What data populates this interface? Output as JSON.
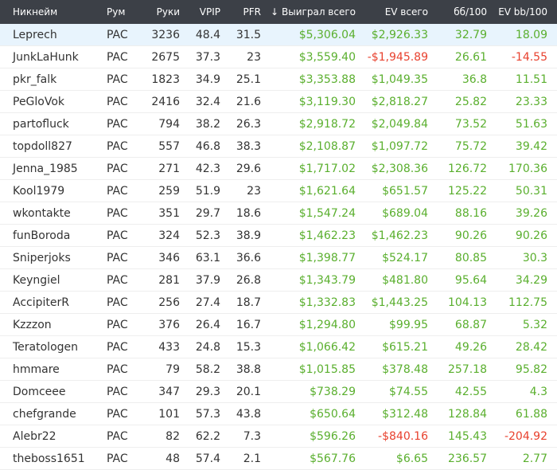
{
  "columns": {
    "nickname": "Никнейм",
    "room": "Рум",
    "hands": "Руки",
    "vpip": "VPIP",
    "pfr": "PFR",
    "sort_icon": "↓",
    "won_total": "Выиграл всего",
    "ev_total": "EV всего",
    "bb100": "бб/100",
    "ev_bb100": "EV bb/100"
  },
  "colors": {
    "header_bg": "#3c4047",
    "positive": "#5aaf2e",
    "negative": "#e8412e",
    "selected_row": "#e8f4fd"
  },
  "rows": [
    {
      "name": "Leprech",
      "room": "PAC",
      "hands": "3236",
      "vpip": "48.4",
      "pfr": "31.5",
      "won": "$5,306.04",
      "won_neg": false,
      "ev": "$2,926.33",
      "ev_neg": false,
      "bb100": "32.79",
      "bb100_neg": false,
      "evbb": "18.09",
      "evbb_neg": false,
      "selected": true
    },
    {
      "name": "JunkLaHunk",
      "room": "PAC",
      "hands": "2675",
      "vpip": "37.3",
      "pfr": "23",
      "won": "$3,559.40",
      "won_neg": false,
      "ev": "-$1,945.89",
      "ev_neg": true,
      "bb100": "26.61",
      "bb100_neg": false,
      "evbb": "-14.55",
      "evbb_neg": true,
      "selected": false
    },
    {
      "name": "pkr_falk",
      "room": "PAC",
      "hands": "1823",
      "vpip": "34.9",
      "pfr": "25.1",
      "won": "$3,353.88",
      "won_neg": false,
      "ev": "$1,049.35",
      "ev_neg": false,
      "bb100": "36.8",
      "bb100_neg": false,
      "evbb": "11.51",
      "evbb_neg": false,
      "selected": false
    },
    {
      "name": "PeGloVok",
      "room": "PAC",
      "hands": "2416",
      "vpip": "32.4",
      "pfr": "21.6",
      "won": "$3,119.30",
      "won_neg": false,
      "ev": "$2,818.27",
      "ev_neg": false,
      "bb100": "25.82",
      "bb100_neg": false,
      "evbb": "23.33",
      "evbb_neg": false,
      "selected": false
    },
    {
      "name": "partofluck",
      "room": "PAC",
      "hands": "794",
      "vpip": "38.2",
      "pfr": "26.3",
      "won": "$2,918.72",
      "won_neg": false,
      "ev": "$2,049.84",
      "ev_neg": false,
      "bb100": "73.52",
      "bb100_neg": false,
      "evbb": "51.63",
      "evbb_neg": false,
      "selected": false
    },
    {
      "name": "topdoll827",
      "room": "PAC",
      "hands": "557",
      "vpip": "46.8",
      "pfr": "38.3",
      "won": "$2,108.87",
      "won_neg": false,
      "ev": "$1,097.72",
      "ev_neg": false,
      "bb100": "75.72",
      "bb100_neg": false,
      "evbb": "39.42",
      "evbb_neg": false,
      "selected": false
    },
    {
      "name": "Jenna_1985",
      "room": "PAC",
      "hands": "271",
      "vpip": "42.3",
      "pfr": "29.6",
      "won": "$1,717.02",
      "won_neg": false,
      "ev": "$2,308.36",
      "ev_neg": false,
      "bb100": "126.72",
      "bb100_neg": false,
      "evbb": "170.36",
      "evbb_neg": false,
      "selected": false
    },
    {
      "name": "Kool1979",
      "room": "PAC",
      "hands": "259",
      "vpip": "51.9",
      "pfr": "23",
      "won": "$1,621.64",
      "won_neg": false,
      "ev": "$651.57",
      "ev_neg": false,
      "bb100": "125.22",
      "bb100_neg": false,
      "evbb": "50.31",
      "evbb_neg": false,
      "selected": false
    },
    {
      "name": "wkontakte",
      "room": "PAC",
      "hands": "351",
      "vpip": "29.7",
      "pfr": "18.6",
      "won": "$1,547.24",
      "won_neg": false,
      "ev": "$689.04",
      "ev_neg": false,
      "bb100": "88.16",
      "bb100_neg": false,
      "evbb": "39.26",
      "evbb_neg": false,
      "selected": false
    },
    {
      "name": "funBoroda",
      "room": "PAC",
      "hands": "324",
      "vpip": "52.3",
      "pfr": "38.9",
      "won": "$1,462.23",
      "won_neg": false,
      "ev": "$1,462.23",
      "ev_neg": false,
      "bb100": "90.26",
      "bb100_neg": false,
      "evbb": "90.26",
      "evbb_neg": false,
      "selected": false
    },
    {
      "name": "Sniperjoks",
      "room": "PAC",
      "hands": "346",
      "vpip": "63.1",
      "pfr": "36.6",
      "won": "$1,398.77",
      "won_neg": false,
      "ev": "$524.17",
      "ev_neg": false,
      "bb100": "80.85",
      "bb100_neg": false,
      "evbb": "30.3",
      "evbb_neg": false,
      "selected": false
    },
    {
      "name": "Keyngiel",
      "room": "PAC",
      "hands": "281",
      "vpip": "37.9",
      "pfr": "26.8",
      "won": "$1,343.79",
      "won_neg": false,
      "ev": "$481.80",
      "ev_neg": false,
      "bb100": "95.64",
      "bb100_neg": false,
      "evbb": "34.29",
      "evbb_neg": false,
      "selected": false
    },
    {
      "name": "AccipiterR",
      "room": "PAC",
      "hands": "256",
      "vpip": "27.4",
      "pfr": "18.7",
      "won": "$1,332.83",
      "won_neg": false,
      "ev": "$1,443.25",
      "ev_neg": false,
      "bb100": "104.13",
      "bb100_neg": false,
      "evbb": "112.75",
      "evbb_neg": false,
      "selected": false
    },
    {
      "name": "Kzzzon",
      "room": "PAC",
      "hands": "376",
      "vpip": "26.4",
      "pfr": "16.7",
      "won": "$1,294.80",
      "won_neg": false,
      "ev": "$99.95",
      "ev_neg": false,
      "bb100": "68.87",
      "bb100_neg": false,
      "evbb": "5.32",
      "evbb_neg": false,
      "selected": false
    },
    {
      "name": "Teratologen",
      "room": "PAC",
      "hands": "433",
      "vpip": "24.8",
      "pfr": "15.3",
      "won": "$1,066.42",
      "won_neg": false,
      "ev": "$615.21",
      "ev_neg": false,
      "bb100": "49.26",
      "bb100_neg": false,
      "evbb": "28.42",
      "evbb_neg": false,
      "selected": false
    },
    {
      "name": "hmmare",
      "room": "PAC",
      "hands": "79",
      "vpip": "58.2",
      "pfr": "38.8",
      "won": "$1,015.85",
      "won_neg": false,
      "ev": "$378.48",
      "ev_neg": false,
      "bb100": "257.18",
      "bb100_neg": false,
      "evbb": "95.82",
      "evbb_neg": false,
      "selected": false
    },
    {
      "name": "Domceee",
      "room": "PAC",
      "hands": "347",
      "vpip": "29.3",
      "pfr": "20.1",
      "won": "$738.29",
      "won_neg": false,
      "ev": "$74.55",
      "ev_neg": false,
      "bb100": "42.55",
      "bb100_neg": false,
      "evbb": "4.3",
      "evbb_neg": false,
      "selected": false
    },
    {
      "name": "chefgrande",
      "room": "PAC",
      "hands": "101",
      "vpip": "57.3",
      "pfr": "43.8",
      "won": "$650.64",
      "won_neg": false,
      "ev": "$312.48",
      "ev_neg": false,
      "bb100": "128.84",
      "bb100_neg": false,
      "evbb": "61.88",
      "evbb_neg": false,
      "selected": false
    },
    {
      "name": "Alebr22",
      "room": "PAC",
      "hands": "82",
      "vpip": "62.2",
      "pfr": "7.3",
      "won": "$596.26",
      "won_neg": false,
      "ev": "-$840.16",
      "ev_neg": true,
      "bb100": "145.43",
      "bb100_neg": false,
      "evbb": "-204.92",
      "evbb_neg": true,
      "selected": false
    },
    {
      "name": "theboss1651",
      "room": "PAC",
      "hands": "48",
      "vpip": "57.4",
      "pfr": "2.1",
      "won": "$567.76",
      "won_neg": false,
      "ev": "$6.65",
      "ev_neg": false,
      "bb100": "236.57",
      "bb100_neg": false,
      "evbb": "2.77",
      "evbb_neg": false,
      "selected": false
    }
  ]
}
